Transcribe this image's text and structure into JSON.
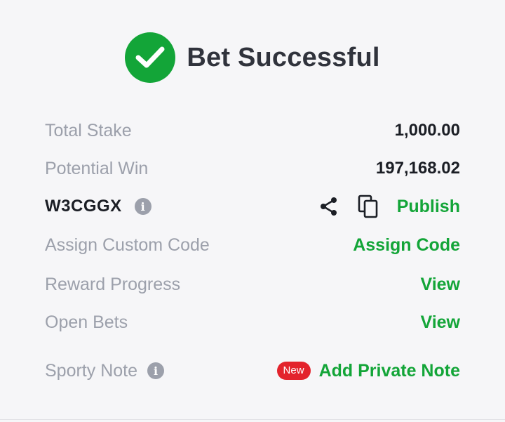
{
  "header": {
    "title": "Bet Successful",
    "success_color": "#13a538"
  },
  "rows": {
    "total_stake": {
      "label": "Total Stake",
      "value": "1,000.00"
    },
    "potential_win": {
      "label": "Potential Win",
      "value": "197,168.02"
    },
    "booking": {
      "code": "W3CGGX",
      "info_icon": "info-icon",
      "share_icon": "share-icon",
      "copy_icon": "copy-icon",
      "publish_label": "Publish"
    },
    "custom_code": {
      "label": "Assign Custom Code",
      "action": "Assign Code"
    },
    "reward_progress": {
      "label": "Reward Progress",
      "action": "View"
    },
    "open_bets": {
      "label": "Open Bets",
      "action": "View"
    },
    "sporty_note": {
      "label": "Sporty Note",
      "badge": "New",
      "action": "Add Private Note"
    }
  },
  "colors": {
    "accent": "#13a538",
    "label": "#9ca0ab",
    "value": "#1b1e25",
    "badge": "#e3232c",
    "background": "#f6f6f8"
  }
}
